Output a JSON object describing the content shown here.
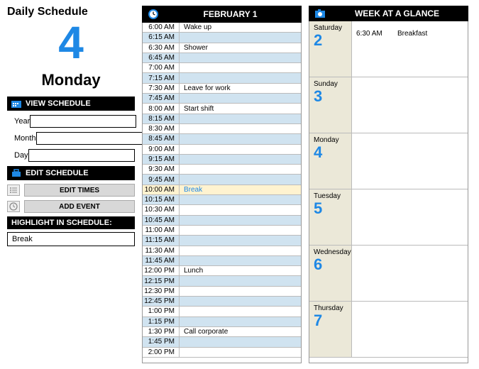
{
  "title": "Daily Schedule",
  "current": {
    "dayNum": "4",
    "dayName": "Monday"
  },
  "viewSchedule": {
    "header": "VIEW SCHEDULE",
    "yearLabel": "Year",
    "monthLabel": "Month",
    "dayLabel": "Day",
    "yearValue": "",
    "monthValue": "",
    "dayValue": ""
  },
  "editSchedule": {
    "header": "EDIT SCHEDULE",
    "editTimes": "EDIT TIMES",
    "addEvent": "ADD EVENT"
  },
  "highlight": {
    "header": "HIGHLIGHT IN SCHEDULE:",
    "value": "Break"
  },
  "dayHeader": "FEBRUARY 1",
  "schedule": [
    {
      "time": "6:00 AM",
      "event": "Wake up",
      "alt": false,
      "hl": false
    },
    {
      "time": "6:15 AM",
      "event": "",
      "alt": true,
      "hl": false
    },
    {
      "time": "6:30 AM",
      "event": "Shower",
      "alt": false,
      "hl": false
    },
    {
      "time": "6:45 AM",
      "event": "",
      "alt": true,
      "hl": false
    },
    {
      "time": "7:00 AM",
      "event": "",
      "alt": false,
      "hl": false
    },
    {
      "time": "7:15 AM",
      "event": "",
      "alt": true,
      "hl": false
    },
    {
      "time": "7:30 AM",
      "event": "Leave for work",
      "alt": false,
      "hl": false
    },
    {
      "time": "7:45 AM",
      "event": "",
      "alt": true,
      "hl": false
    },
    {
      "time": "8:00 AM",
      "event": "Start shift",
      "alt": false,
      "hl": false
    },
    {
      "time": "8:15 AM",
      "event": "",
      "alt": true,
      "hl": false
    },
    {
      "time": "8:30 AM",
      "event": "",
      "alt": false,
      "hl": false
    },
    {
      "time": "8:45 AM",
      "event": "",
      "alt": true,
      "hl": false
    },
    {
      "time": "9:00 AM",
      "event": "",
      "alt": false,
      "hl": false
    },
    {
      "time": "9:15 AM",
      "event": "",
      "alt": true,
      "hl": false
    },
    {
      "time": "9:30 AM",
      "event": "",
      "alt": false,
      "hl": false
    },
    {
      "time": "9:45 AM",
      "event": "",
      "alt": true,
      "hl": false
    },
    {
      "time": "10:00 AM",
      "event": "Break",
      "alt": false,
      "hl": true
    },
    {
      "time": "10:15 AM",
      "event": "",
      "alt": true,
      "hl": false
    },
    {
      "time": "10:30 AM",
      "event": "",
      "alt": false,
      "hl": false
    },
    {
      "time": "10:45 AM",
      "event": "",
      "alt": true,
      "hl": false
    },
    {
      "time": "11:00 AM",
      "event": "",
      "alt": false,
      "hl": false
    },
    {
      "time": "11:15 AM",
      "event": "",
      "alt": true,
      "hl": false
    },
    {
      "time": "11:30 AM",
      "event": "",
      "alt": false,
      "hl": false
    },
    {
      "time": "11:45 AM",
      "event": "",
      "alt": true,
      "hl": false
    },
    {
      "time": "12:00 PM",
      "event": "Lunch",
      "alt": false,
      "hl": false
    },
    {
      "time": "12:15 PM",
      "event": "",
      "alt": true,
      "hl": false
    },
    {
      "time": "12:30 PM",
      "event": "",
      "alt": false,
      "hl": false
    },
    {
      "time": "12:45 PM",
      "event": "",
      "alt": true,
      "hl": false
    },
    {
      "time": "1:00 PM",
      "event": "",
      "alt": false,
      "hl": false
    },
    {
      "time": "1:15 PM",
      "event": "",
      "alt": true,
      "hl": false
    },
    {
      "time": "1:30 PM",
      "event": "Call corporate",
      "alt": false,
      "hl": false
    },
    {
      "time": "1:45 PM",
      "event": "",
      "alt": true,
      "hl": false
    },
    {
      "time": "2:00 PM",
      "event": "",
      "alt": false,
      "hl": false
    }
  ],
  "weekHeader": "WEEK AT A GLANCE",
  "week": [
    {
      "day": "Saturday",
      "num": "2",
      "events": [
        {
          "time": "6:30 AM",
          "label": "Breakfast"
        }
      ]
    },
    {
      "day": "Sunday",
      "num": "3",
      "events": []
    },
    {
      "day": "Monday",
      "num": "4",
      "events": []
    },
    {
      "day": "Tuesday",
      "num": "5",
      "events": []
    },
    {
      "day": "Wednesday",
      "num": "6",
      "events": []
    },
    {
      "day": "Thursday",
      "num": "7",
      "events": []
    }
  ],
  "colors": {
    "accent": "#1e88e5",
    "header": "#000000"
  }
}
